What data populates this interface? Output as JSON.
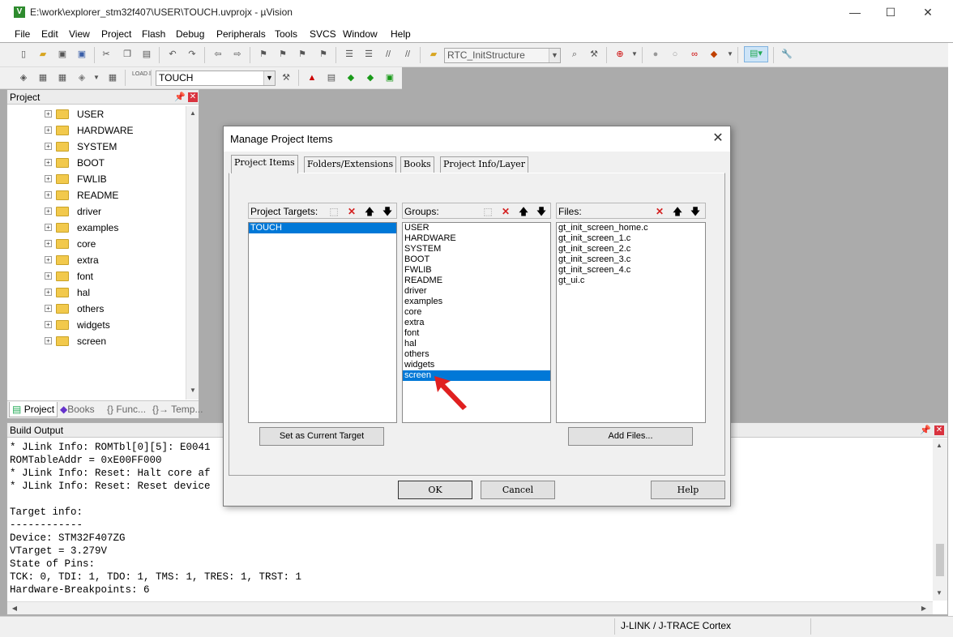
{
  "window": {
    "title": "E:\\work\\explorer_stm32f407\\USER\\TOUCH.uvprojx - µVision",
    "icon_letter": "V",
    "controls": [
      "—",
      "☐",
      "✕"
    ]
  },
  "menu": [
    "File",
    "Edit",
    "View",
    "Project",
    "Flash",
    "Debug",
    "Peripherals",
    "Tools",
    "SVCS",
    "Window",
    "Help"
  ],
  "toolbar": {
    "function_combo": "RTC_InitStructure",
    "target_combo": "TOUCH"
  },
  "project_panel": {
    "title": "Project",
    "tree": [
      "USER",
      "HARDWARE",
      "SYSTEM",
      "BOOT",
      "FWLIB",
      "README",
      "driver",
      "examples",
      "core",
      "extra",
      "font",
      "hal",
      "others",
      "widgets",
      "screen"
    ],
    "tabs": [
      "Project",
      "Books",
      "{} Func...",
      "{}→ Temp..."
    ]
  },
  "build_output": {
    "title": "Build Output",
    "lines": [
      "* JLink Info: ROMTbl[0][5]: E0041",
      "ROMTableAddr = 0xE00FF000",
      "* JLink Info: Reset: Halt core af",
      "* JLink Info: Reset: Reset device",
      "",
      "Target info:",
      "------------",
      "Device: STM32F407ZG",
      "VTarget = 3.279V",
      "State of Pins:",
      "TCK: 0, TDI: 1, TDO: 1, TMS: 1, TRES: 1, TRST: 1",
      "Hardware-Breakpoints: 6"
    ]
  },
  "status_bar": {
    "debugger": "J-LINK / J-TRACE Cortex"
  },
  "dialog": {
    "title": "Manage Project Items",
    "tabs": [
      "Project Items",
      "Folders/Extensions",
      "Books",
      "Project Info/Layer"
    ],
    "targets_label": "Project Targets:",
    "targets": [
      "TOUCH"
    ],
    "selected_target": "TOUCH",
    "groups_label": "Groups:",
    "groups": [
      "USER",
      "HARDWARE",
      "SYSTEM",
      "BOOT",
      "FWLIB",
      "README",
      "driver",
      "examples",
      "core",
      "extra",
      "font",
      "hal",
      "others",
      "widgets",
      "screen"
    ],
    "selected_group": "screen",
    "files_label": "Files:",
    "files": [
      "gt_init_screen_home.c",
      "gt_init_screen_1.c",
      "gt_init_screen_2.c",
      "gt_init_screen_3.c",
      "gt_init_screen_4.c",
      "gt_ui.c"
    ],
    "set_target_button": "Set as Current Target",
    "add_files_button": "Add Files...",
    "ok_button": "OK",
    "cancel_button": "Cancel",
    "help_button": "Help"
  },
  "colors": {
    "selection": "#0078d7",
    "annotation_arrow": "#e02020",
    "workspace": "#ababab"
  }
}
